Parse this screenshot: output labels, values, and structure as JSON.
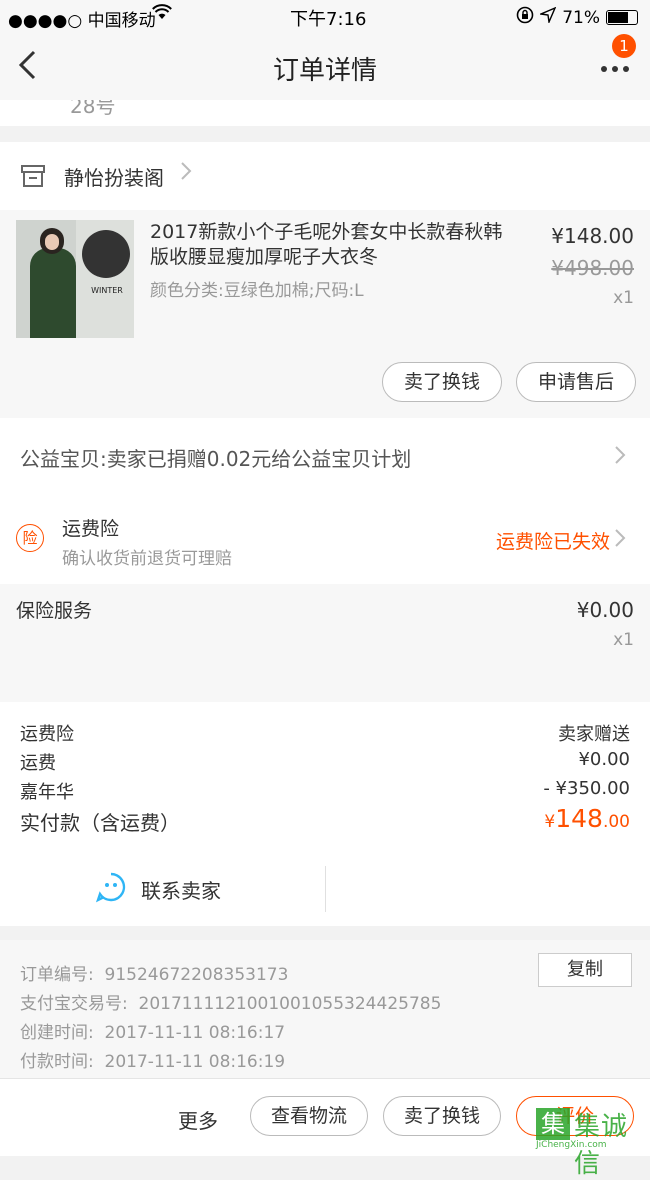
{
  "status_bar": {
    "carrier": "●●●●○ 中国移动",
    "time": "下午7:16",
    "battery": "71%"
  },
  "nav": {
    "title": "订单详情",
    "badge": "1"
  },
  "address_fragment": "28号",
  "shop": {
    "name": "静怡扮装阁"
  },
  "item": {
    "title": "2017新款小个子毛呢外套女中长款春秋韩版收腰显瘦加厚呢子大衣冬",
    "sku": "颜色分类:豆绿色加棉;尺码:L",
    "price": "¥148.00",
    "original_price": "¥498.00",
    "qty": "x1",
    "image_text": "WINTER",
    "btn_sell": "卖了换钱",
    "btn_aftersale": "申请售后"
  },
  "charity": {
    "text": "公益宝贝:卖家已捐赠0.02元给公益宝贝计划"
  },
  "shipping_insurance": {
    "icon": "险",
    "title": "运费险",
    "desc": "确认收货前退货可理赔",
    "status": "运费险已失效"
  },
  "insurance_service": {
    "title": "保险服务",
    "price": "¥0.00",
    "qty": "x1"
  },
  "summary": {
    "rows": [
      {
        "label": "运费险",
        "value": "卖家赠送"
      },
      {
        "label": "运费",
        "value": "¥0.00"
      },
      {
        "label": "嘉年华",
        "value": "- ¥350.00"
      }
    ],
    "total_label": "实付款（含运费）",
    "total_symbol": "¥",
    "total_int": "148",
    "total_dec": ".00"
  },
  "contact": {
    "label": "联系卖家"
  },
  "order_info": {
    "copy_label": "复制",
    "rows": [
      {
        "label": "订单编号:",
        "value": "91524672208353173"
      },
      {
        "label": "支付宝交易号:",
        "value": "2017111121001001055324425785"
      },
      {
        "label": "创建时间:",
        "value": "2017-11-11 08:16:17"
      },
      {
        "label": "付款时间:",
        "value": "2017-11-11 08:16:19"
      }
    ]
  },
  "bottom_bar": {
    "more": "更多",
    "logistics": "查看物流",
    "sell": "卖了换钱",
    "review": "评价"
  },
  "watermark": {
    "text": "集诚信",
    "sub": "JiChengXin.com"
  },
  "colors": {
    "accent": "#ff5000",
    "chat_icon": "#2fb5f5"
  }
}
